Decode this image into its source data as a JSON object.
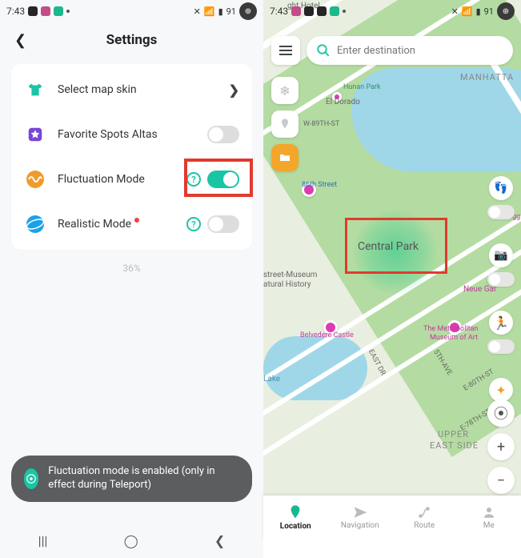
{
  "left": {
    "status": {
      "time": "7:43",
      "battery": "91"
    },
    "header": {
      "title": "Settings"
    },
    "rows": {
      "skin": {
        "label": "Select map skin"
      },
      "fav": {
        "label": "Favorite Spots Altas"
      },
      "fluct": {
        "label": "Fluctuation Mode"
      },
      "real": {
        "label": "Realistic Mode"
      }
    },
    "percent": "36%",
    "toast": "Fluctuation mode is enabled (only in effect during Teleport)"
  },
  "right": {
    "status": {
      "time": "7:43",
      "battery": "91"
    },
    "search": {
      "placeholder": "Enter destination"
    },
    "labels": {
      "hotel": "ght Hotel",
      "manhattan": "MANHATTA",
      "hunan": "Hunan Park",
      "eldorado": "El Dorado",
      "w89": "W-89TH-ST",
      "street86": "86th Street",
      "central": "Central Park",
      "museum1a": "street-Museum",
      "museum1b": "atural History",
      "belv": "Belvedere Castle",
      "met1": "The Metropolitan",
      "met2": "Museum of Art",
      "neug": "Neue Gal",
      "eastdr": "EAST DR",
      "ave5": "5TH-AVE",
      "e80": "E-80TH-ST",
      "e78": "E-78TH-ST",
      "upper1": "UPPER",
      "upper2": "EAST SIDE",
      "lake": "Lake",
      "gugg": "Gugg"
    },
    "bottomnav": {
      "location": "Location",
      "navigation": "Navigation",
      "route": "Route",
      "me": "Me"
    }
  }
}
